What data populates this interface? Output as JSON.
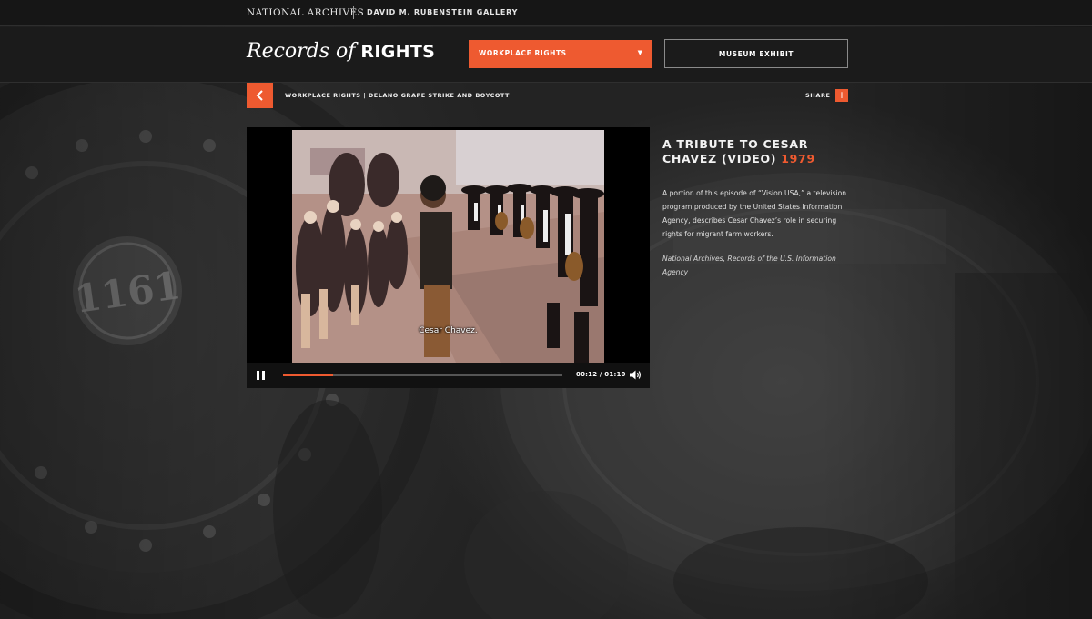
{
  "topbar": {
    "national_archives": "NATIONAL ARCHIVES",
    "gallery": "DAVID M. RUBENSTEIN GALLERY"
  },
  "header": {
    "logo_script": "Records of",
    "logo_bold": "RIGHTS",
    "category_select": "WORKPLACE RIGHTS",
    "select_arrow": "▼",
    "museum_button": "MUSEUM EXHIBIT"
  },
  "breadcrumb": {
    "path": "WORKPLACE RIGHTS | DELANO GRAPE STRIKE AND BOYCOTT",
    "share": "SHARE",
    "share_plus": "+"
  },
  "video": {
    "subtitle": "Cesar Chavez.",
    "time": "00:12 / 01:10",
    "progress": 0.18
  },
  "record": {
    "title": "A TRIBUTE TO CESAR CHAVEZ (VIDEO)",
    "year": "1979",
    "description": "A portion of this episode of “Vision USA,” a television program produced by the United States Information Agency, describes Cesar Chavez’s role in securing rights for migrant farm workers.",
    "credit": "National Archives, Records of the U.S. Information Agency"
  },
  "background": {
    "engine_number": "1161"
  },
  "colors": {
    "accent": "#ee5a30",
    "topbar": "#161616",
    "header": "#1b1b1b"
  }
}
